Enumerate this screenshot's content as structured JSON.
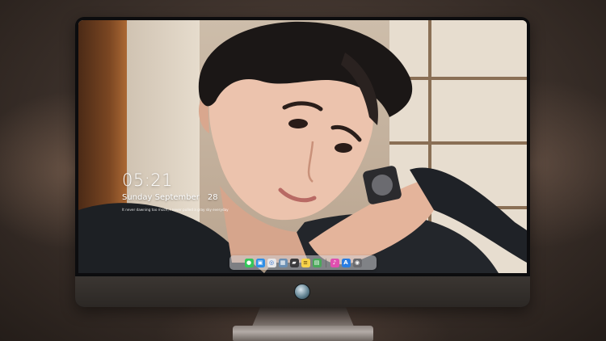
{
  "lock_screen": {
    "time": "05:21",
    "weekday_month": "Sunday September",
    "day": "28",
    "caption": "It never dawning too much, I never pulled a gray sky everyday"
  },
  "dock": {
    "apps": [
      {
        "name": "messages-icon",
        "color": "#35c759",
        "glyph": "●"
      },
      {
        "name": "finder-icon",
        "color": "#2f8fe6",
        "glyph": "▣"
      },
      {
        "name": "safari-icon",
        "color": "#e8e8ea",
        "glyph": "◎"
      },
      {
        "name": "preview-icon",
        "color": "#6b8fb3",
        "glyph": "▦"
      },
      {
        "name": "clapper-icon",
        "color": "#3a3a3c",
        "glyph": "▰"
      },
      {
        "name": "notes-icon",
        "color": "#f7d34b",
        "glyph": "≡"
      },
      {
        "name": "photos-icon",
        "color": "#4aa85a",
        "glyph": "▤"
      },
      {
        "name": "itunes-icon",
        "color": "#e04fb0",
        "glyph": "♪"
      },
      {
        "name": "app-store-icon",
        "color": "#2a7de1",
        "glyph": "A"
      },
      {
        "name": "camera-icon",
        "color": "#6a6a6e",
        "glyph": "◉"
      }
    ]
  },
  "colors": {
    "monitor_bezel": "#0c0c0e",
    "monitor_chin": "#3b3632",
    "dock_background": "rgba(205,205,210,0.55)"
  }
}
